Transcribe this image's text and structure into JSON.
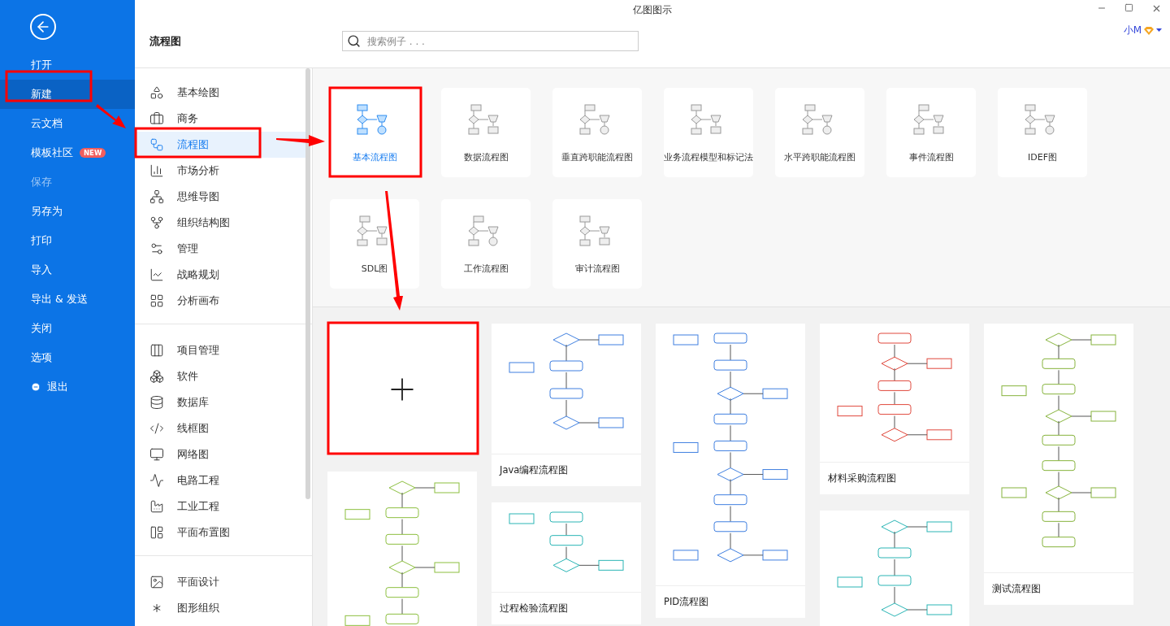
{
  "window": {
    "title": "亿图图示",
    "user": "小M"
  },
  "nav": {
    "items": [
      {
        "label": "打开",
        "selected": false,
        "disabled": false
      },
      {
        "label": "新建",
        "selected": true,
        "disabled": false
      },
      {
        "label": "云文档",
        "selected": false,
        "disabled": false
      },
      {
        "label": "模板社区",
        "selected": false,
        "disabled": false,
        "badge": "NEW"
      },
      {
        "label": "保存",
        "selected": false,
        "disabled": true
      },
      {
        "label": "另存为",
        "selected": false,
        "disabled": false
      },
      {
        "label": "打印",
        "selected": false,
        "disabled": false
      },
      {
        "label": "导入",
        "selected": false,
        "disabled": false
      },
      {
        "label": "导出 & 发送",
        "selected": false,
        "disabled": false
      },
      {
        "label": "关闭",
        "selected": false,
        "disabled": false
      },
      {
        "label": "选项",
        "selected": false,
        "disabled": false
      },
      {
        "label": "退出",
        "selected": false,
        "disabled": false,
        "kind": "exit"
      }
    ]
  },
  "heading": "流程图",
  "search": {
    "placeholder": "搜索例子 . . ."
  },
  "categories": [
    [
      {
        "label": "基本绘图",
        "selected": false
      },
      {
        "label": "商务",
        "selected": false
      },
      {
        "label": "流程图",
        "selected": true
      },
      {
        "label": "市场分析",
        "selected": false
      },
      {
        "label": "思维导图",
        "selected": false
      },
      {
        "label": "组织结构图",
        "selected": false
      },
      {
        "label": "管理",
        "selected": false
      },
      {
        "label": "战略规划",
        "selected": false
      },
      {
        "label": "分析画布",
        "selected": false
      }
    ],
    [
      {
        "label": "项目管理",
        "selected": false
      },
      {
        "label": "软件",
        "selected": false
      },
      {
        "label": "数据库",
        "selected": false
      },
      {
        "label": "线框图",
        "selected": false
      },
      {
        "label": "网络图",
        "selected": false
      },
      {
        "label": "电路工程",
        "selected": false
      },
      {
        "label": "工业工程",
        "selected": false
      },
      {
        "label": "平面布置图",
        "selected": false
      }
    ],
    [
      {
        "label": "平面设计",
        "selected": false
      },
      {
        "label": "图形组织",
        "selected": false
      }
    ]
  ],
  "diagram_types": [
    {
      "label": "基本流程图",
      "selected": true
    },
    {
      "label": "数据流程图",
      "selected": false
    },
    {
      "label": "垂直跨职能流程图",
      "selected": false
    },
    {
      "label": "业务流程模型和标记法",
      "selected": false
    },
    {
      "label": "水平跨职能流程图",
      "selected": false
    },
    {
      "label": "事件流程图",
      "selected": false
    },
    {
      "label": "IDEF图",
      "selected": false
    },
    {
      "label": "SDL图",
      "selected": false
    },
    {
      "label": "工作流程图",
      "selected": false
    },
    {
      "label": "审计流程图",
      "selected": false
    }
  ],
  "template_columns": [
    [
      {
        "kind": "blank"
      },
      {
        "kind": "template"
      }
    ],
    [
      {
        "kind": "template",
        "title": "Java编程流程图"
      },
      {
        "kind": "template",
        "title": "过程检验流程图"
      }
    ],
    [
      {
        "kind": "template",
        "title": "PID流程图"
      }
    ],
    [
      {
        "kind": "template",
        "title": "材料采购流程图"
      },
      {
        "kind": "template"
      }
    ],
    [
      {
        "kind": "template",
        "title": "测试流程图"
      }
    ]
  ]
}
